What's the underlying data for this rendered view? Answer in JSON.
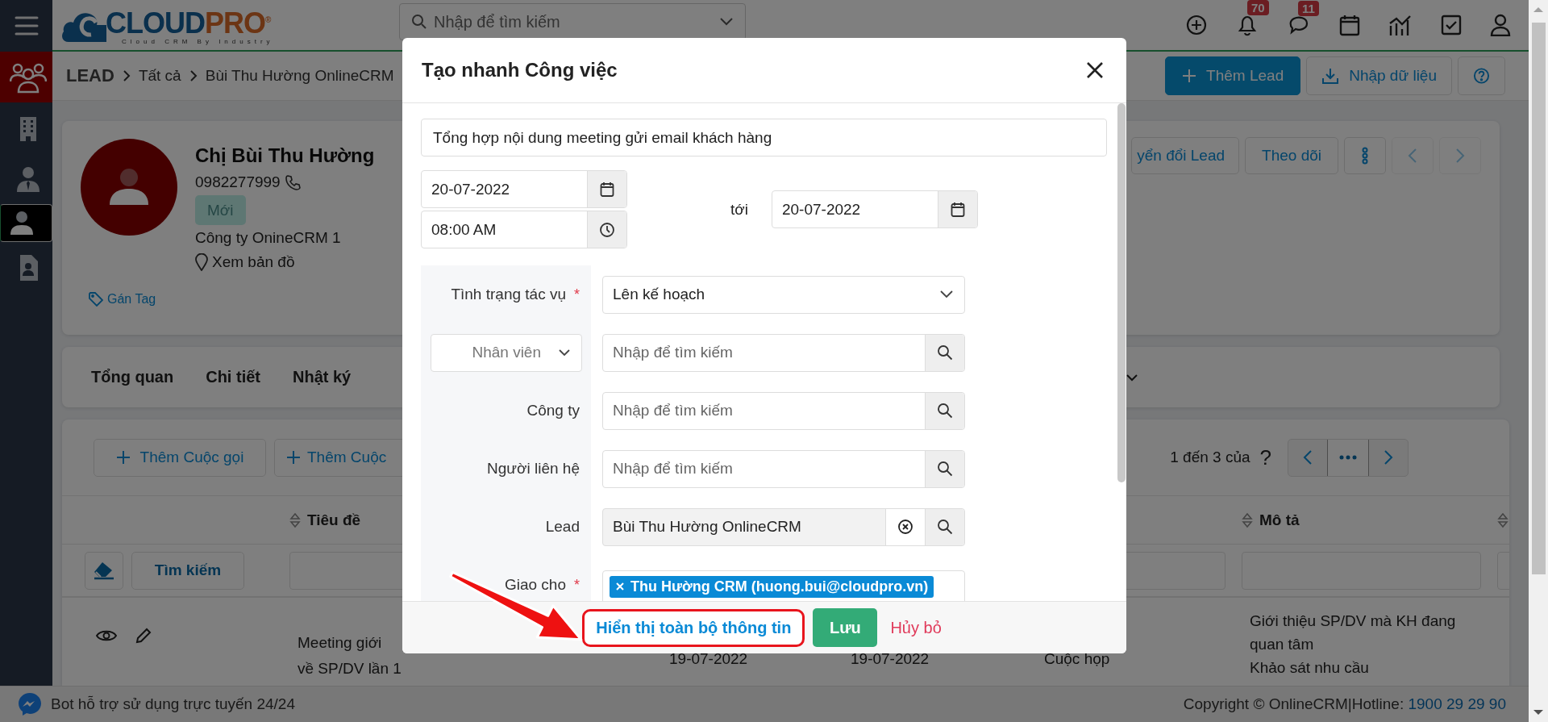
{
  "sidebar": {
    "items": [
      {
        "module": true,
        "selected": false
      },
      {
        "module": false,
        "selected": false
      },
      {
        "module": false,
        "selected": false
      },
      {
        "module": false,
        "selected": true
      },
      {
        "module": false,
        "selected": false
      }
    ]
  },
  "top_bar": {
    "logo": {
      "part_1": "CLOUD",
      "part_2": "PRO",
      "mark": "®",
      "tagline": "Cloud CRM By Industry"
    },
    "search": {
      "placeholder": "Nhập để tìm kiếm"
    },
    "notifications_badge": "70",
    "messages_badge": "11"
  },
  "breadcrumb": [
    "LEAD",
    "Tất cả",
    "Bùi Thu Hường OnlineCRM"
  ],
  "header_actions": {
    "add": "Thêm Lead",
    "import": "Nhập dữ liệu"
  },
  "profile": {
    "name": "Chị Bùi Thu Hường",
    "phone": "0982277999",
    "status": "Mới",
    "company": "Công ty OnineCRM 1",
    "map_link": "Xem bản đồ",
    "tag_link": "Gán Tag",
    "buttons": [
      "yển đổi Lead",
      "Theo dõi"
    ]
  },
  "tabs": [
    "Tổng quan",
    "Chi tiết",
    "Nhật ký"
  ],
  "activities": {
    "buttons": [
      "Thêm Cuộc gọi",
      "Thêm Cuộc"
    ],
    "pagination": {
      "summary": "1 đến 3 của",
      "total": "?"
    },
    "columns": [
      {
        "label": "Tiêu đề"
      },
      {
        "label": "Mô tả"
      }
    ],
    "search_button": "Tìm kiếm",
    "row": {
      "title": [
        "Meeting giới",
        "về SP/DV lần 1"
      ],
      "start": "19-07-2022",
      "end": "19-07-2022",
      "type": "Cuộc họp",
      "description": [
        "Giới thiệu SP/DV mà KH đang",
        "quan tâm",
        "Khảo sát nhu cầu"
      ]
    }
  },
  "status_bar": {
    "bot": "Bot hỗ trợ sử dụng trực tuyến 24/24",
    "copyright": "Copyright © OnlineCRM|Hotline: ",
    "hotline": "1900 29 29 90"
  },
  "modal": {
    "title": "Tạo nhanh Công việc",
    "subject": "Tổng hợp nội dung meeting gửi email khách hàng",
    "start_date": "20-07-2022",
    "start_time": "08:00 AM",
    "to_label": "tới",
    "end_date": "20-07-2022",
    "fields": [
      {
        "kind": "select",
        "label": "Tình trạng tác vụ",
        "required_mark": "*",
        "value": "Lên kế hoạch"
      },
      {
        "kind": "typed_lookup",
        "type": "Nhân viên",
        "placeholder": "Nhập để tìm kiếm",
        "clearable": false
      },
      {
        "kind": "lookup",
        "label": "Công ty",
        "placeholder": "Nhập để tìm kiếm",
        "clearable": false
      },
      {
        "kind": "lookup",
        "label": "Người liên hệ",
        "placeholder": "Nhập để tìm kiếm",
        "clearable": false
      },
      {
        "kind": "lookup",
        "label": "Lead",
        "value": "Bùi Thu Hường OnlineCRM",
        "clearable": true
      },
      {
        "kind": "tags",
        "label": "Giao cho",
        "required_mark": "*",
        "tags": [
          "Thu Hường CRM (huong.bui@cloudpro.vn)"
        ]
      }
    ],
    "footer": {
      "more": "Hiển thị toàn bộ thông tin",
      "save": "Lưu",
      "cancel": "Hủy bỏ"
    }
  }
}
